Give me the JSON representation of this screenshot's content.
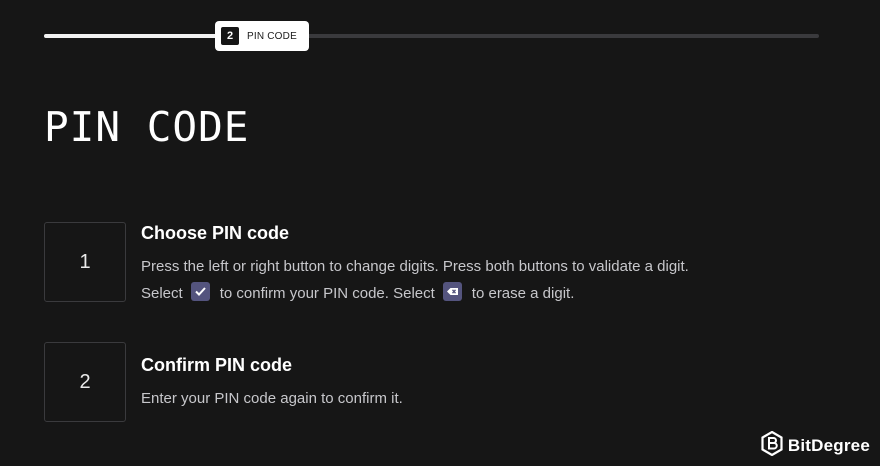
{
  "progress": {
    "fill_fraction": 0.31,
    "step_number": "2",
    "step_label": "PIN CODE"
  },
  "page_title": "PIN CODE",
  "steps": [
    {
      "number": "1",
      "heading": "Choose PIN code",
      "line1": "Press the left or right button to change digits. Press both buttons to validate a digit.",
      "line2_a": "Select",
      "line2_b": "to confirm your PIN code. Select",
      "line2_c": "to erase a digit.",
      "icons": [
        "checkmark-icon",
        "backspace-icon"
      ]
    },
    {
      "number": "2",
      "heading": "Confirm PIN code",
      "line1": "Enter your PIN code again to confirm it."
    }
  ],
  "brand": {
    "name": "BitDegree",
    "icon": "bitdegree-logo-icon"
  },
  "colors": {
    "background": "#161616",
    "icon_bg": "#54547e",
    "track": "#3a3a3d"
  }
}
